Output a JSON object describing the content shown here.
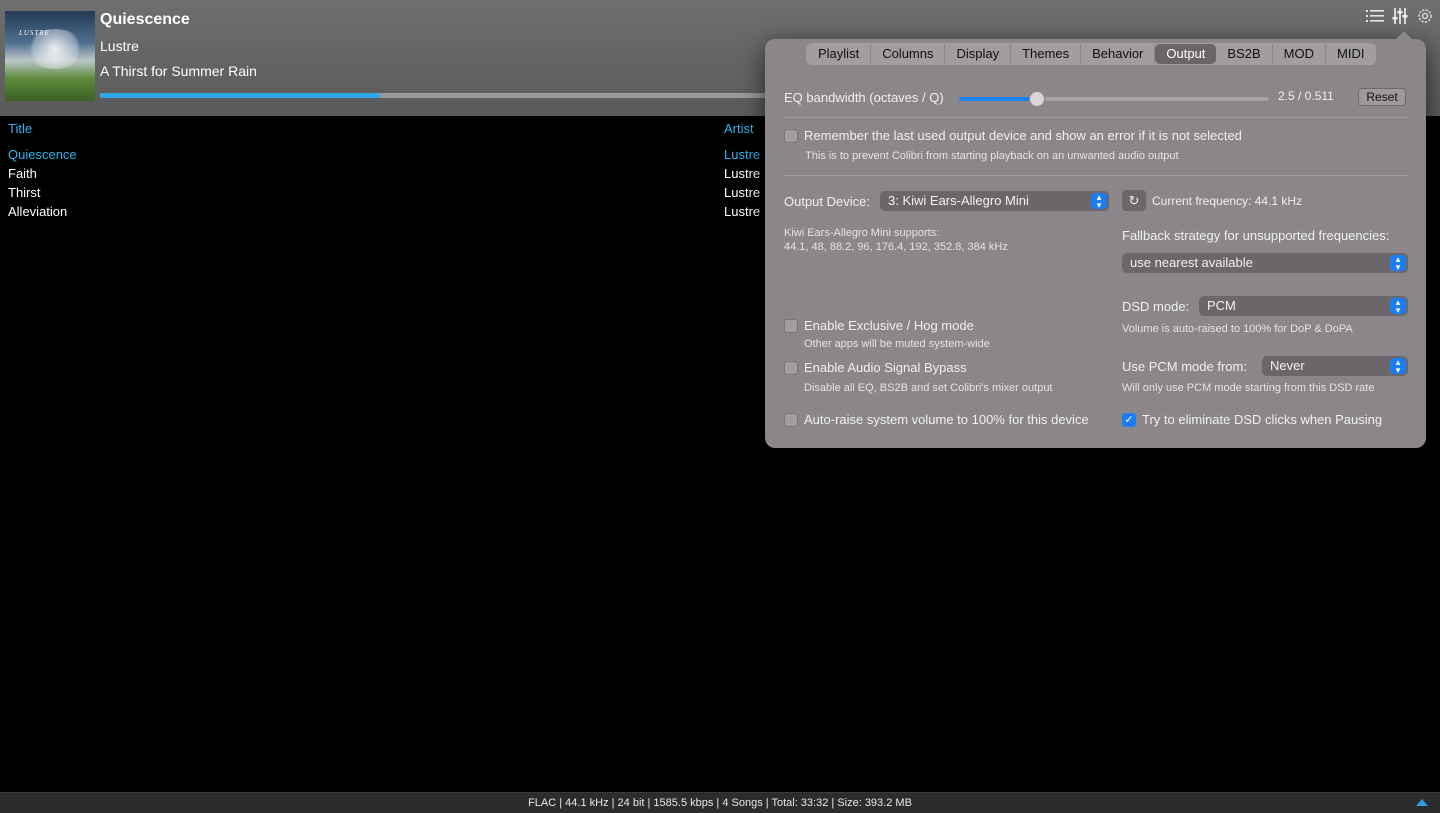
{
  "now_playing": {
    "title": "Quiescence",
    "artist": "Lustre",
    "album": "A Thirst for Summer Rain",
    "art_text": "LUSTRE",
    "progress": 0.4
  },
  "header_icons": [
    "list-icon",
    "equalizer-icon",
    "gear-icon"
  ],
  "playlist": {
    "columns": {
      "title": "Title",
      "artist": "Artist"
    },
    "rows": [
      {
        "title": "Quiescence",
        "artist": "Lustre",
        "active": true
      },
      {
        "title": "Faith",
        "artist": "Lustre",
        "active": false
      },
      {
        "title": "Thirst",
        "artist": "Lustre",
        "active": false
      },
      {
        "title": "Alleviation",
        "artist": "Lustre",
        "active": false
      }
    ]
  },
  "status_bar": {
    "text": "FLAC | 44.1 kHz | 24 bit | 1585.5 kbps | 4 Songs | Total: 33:32 | Size: 393.2 MB"
  },
  "settings": {
    "tabs": [
      "Playlist",
      "Columns",
      "Display",
      "Themes",
      "Behavior",
      "Output",
      "BS2B",
      "MOD",
      "MIDI"
    ],
    "selected_tab": "Output",
    "eq_bandwidth": {
      "label": "EQ bandwidth (octaves / Q)",
      "value_text": "2.5 / 0.511",
      "slider_fraction": 0.25,
      "reset_label": "Reset"
    },
    "remember_device": {
      "label": "Remember the last used output device and show an error if it is not selected",
      "description": "This is to prevent Colibri from starting playback on an unwanted audio output",
      "checked": false
    },
    "output_device": {
      "label": "Output Device:",
      "value": "3: Kiwi Ears-Allegro Mini",
      "supports_title": "Kiwi Ears-Allegro Mini supports:",
      "supports_rates": "44.1, 48, 88.2, 96, 176.4, 192, 352.8, 384 kHz"
    },
    "current_frequency": "Current frequency: 44.1 kHz",
    "fallback": {
      "label": "Fallback strategy for unsupported frequencies:",
      "value": "use nearest available"
    },
    "dsd_mode": {
      "label": "DSD mode:",
      "value": "PCM",
      "note": "Volume is auto-raised to 100% for DoP & DoPA"
    },
    "use_pcm_from": {
      "label": "Use PCM mode from:",
      "value": "Never",
      "note": "Will only use PCM mode starting from this DSD rate"
    },
    "exclusive_mode": {
      "label": "Enable Exclusive / Hog mode",
      "description": "Other apps will be muted system-wide",
      "checked": false
    },
    "signal_bypass": {
      "label": "Enable Audio Signal Bypass",
      "description": "Disable all EQ, BS2B and set Colibri's mixer output",
      "checked": false
    },
    "auto_raise": {
      "label": "Auto-raise system volume to 100% for this device",
      "checked": false
    },
    "dsd_clicks": {
      "label": "Try to eliminate DSD clicks when Pausing",
      "checked": true
    }
  }
}
